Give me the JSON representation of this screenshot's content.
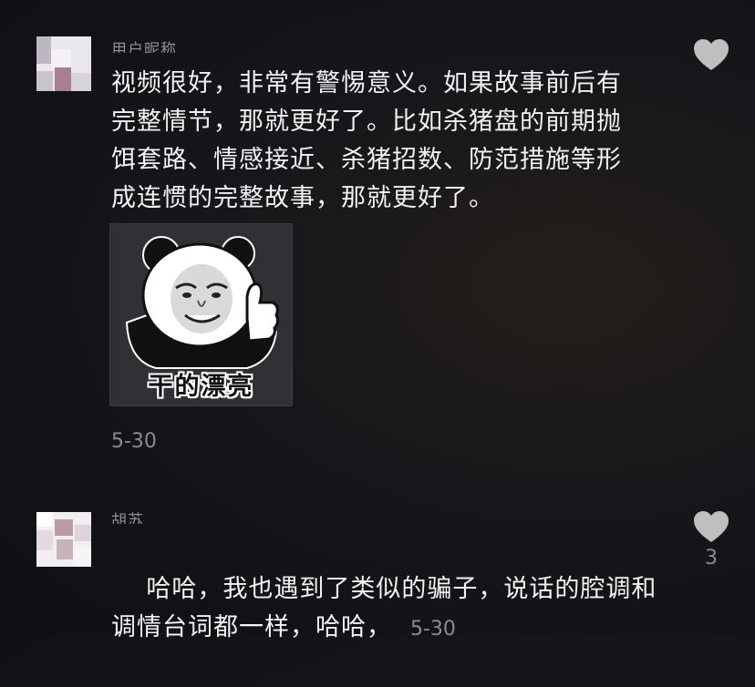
{
  "comments": [
    {
      "username": "用户昵称",
      "text": "视频很好，非常有警惕意义。如果故事前后有\n完整情节，那就更好了。比如杀猪盘的前期抛\n饵套路、情感接近、杀猪招数、防范措施等形\n成连惯的完整故事，那就更好了。",
      "sticker_caption": "干的漂亮",
      "timestamp": "5-30",
      "like_count": ""
    },
    {
      "username": "胡苏",
      "text": "哈哈，我也遇到了类似的骗子，说话的腔调和\n调情台词都一样，哈哈，",
      "timestamp": "5-30",
      "like_count": "3"
    }
  ],
  "colors": {
    "text": "#f2f2f2",
    "secondary": "#8a8a8f",
    "heart": "#bfbfbf"
  },
  "icons": {
    "like": "heart-icon"
  }
}
